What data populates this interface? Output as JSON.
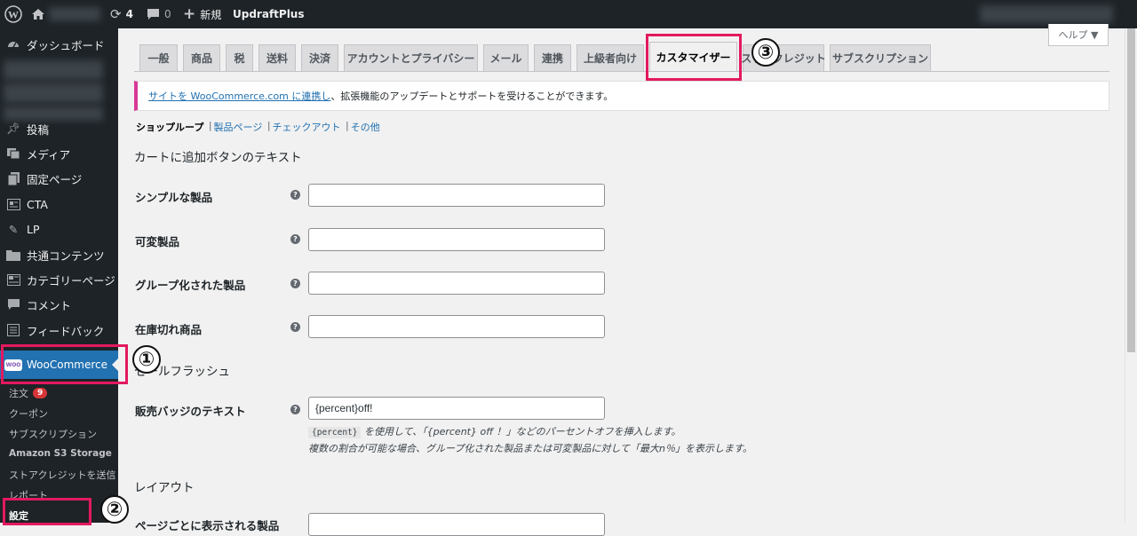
{
  "adminbar": {
    "updates_count": "4",
    "comments_count": "0",
    "new_label": "新規",
    "plugin_label": "UpdraftPlus"
  },
  "sidebar": {
    "dashboard": "ダッシュボード",
    "posts": "投稿",
    "media": "メディア",
    "pages": "固定ページ",
    "cta": "CTA",
    "lp": "LP",
    "common": "共通コンテンツ",
    "category_pages": "カテゴリーページ",
    "comments": "コメント",
    "feedback": "フィードバック",
    "woocommerce": "WooCommerce",
    "woo_logo": "WOO",
    "subitems": {
      "orders": "注文",
      "orders_badge": "9",
      "coupons": "クーポン",
      "subscriptions": "サブスクリプション",
      "amazon": "Amazon S3 Storage",
      "store_credit": "ストアクレジットを送信",
      "reports": "レポート",
      "settings": "設定"
    }
  },
  "help_button": "ヘルプ ▼",
  "tabs": [
    "一般",
    "商品",
    "税",
    "送料",
    "決済",
    "アカウントとプライバシー",
    "メール",
    "連携",
    "上級者向け",
    "カスタマイザー",
    "ストアクレジット",
    "サブスクリプション"
  ],
  "notice": {
    "link": "サイトを WooCommerce.com に連携し",
    "text": "、拡張機能のアップデートとサポートを受けることができます。"
  },
  "subnav": {
    "current": "ショップループ",
    "product_page": "製品ページ",
    "checkout": "チェックアウト",
    "other": "その他"
  },
  "section1": "カートに追加ボタンのテキスト",
  "fields": {
    "simple": "シンプルな製品",
    "variable": "可変製品",
    "grouped": "グループ化された製品",
    "out_of_stock": "在庫切れ商品"
  },
  "section2": "セールフラッシュ",
  "sale_badge": {
    "label": "販売バッジのテキスト",
    "value": "{percent}off!",
    "code": "{percent}",
    "desc1": "を使用して、「{percent} off ！」などのパーセントオフを挿入します。",
    "desc2": "複数の割合が可能な場合、グループ化された製品または可変製品に対して「最大n％」を表示します。"
  },
  "section3": "レイアウト",
  "layout_field_label": "ページごとに表示される製品",
  "annotations": {
    "one": "①",
    "two": "②",
    "three": "③"
  }
}
